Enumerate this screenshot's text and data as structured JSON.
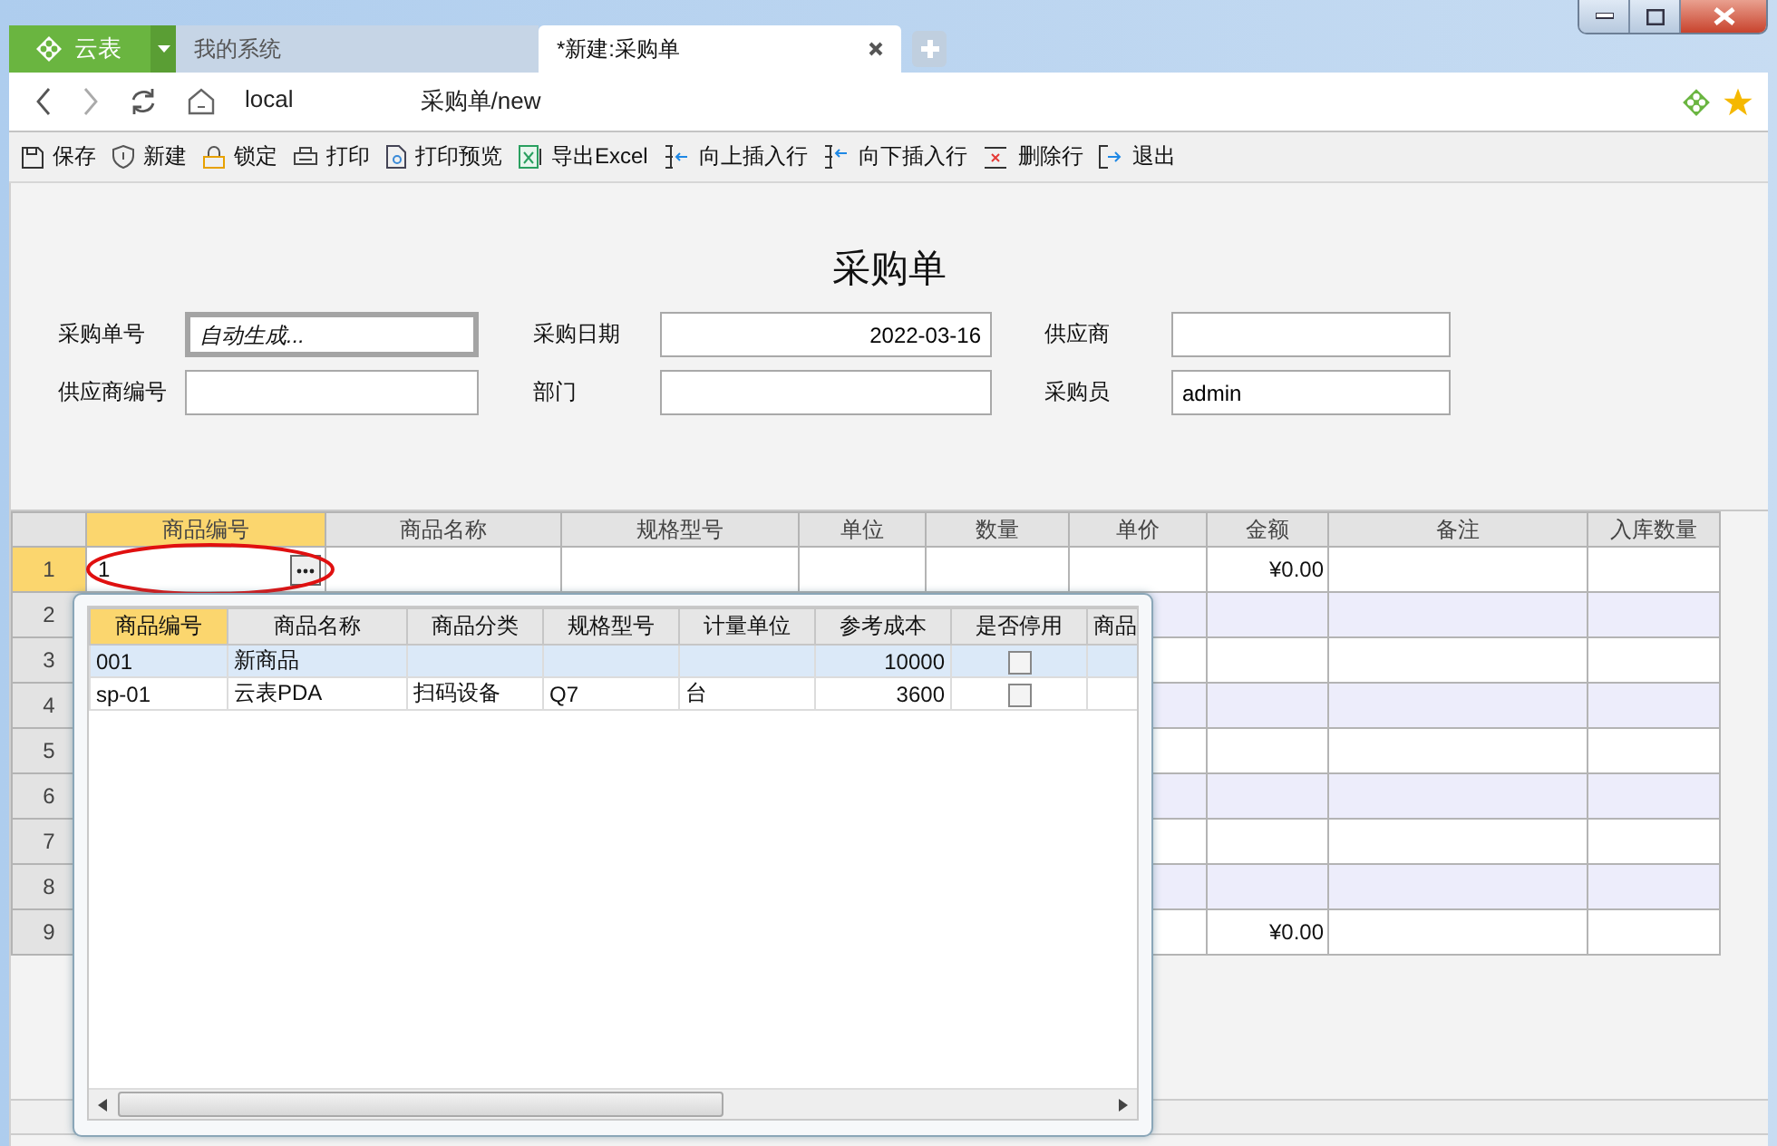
{
  "browser": {
    "app_tab": "云表",
    "tabs": [
      {
        "label": "我的系统",
        "selected": false
      },
      {
        "label": "*新建:采购单",
        "selected": true
      }
    ],
    "address": {
      "prefix": "local",
      "suffix": "采购单/new"
    }
  },
  "toolbar": [
    {
      "kind": "save",
      "label": "保存"
    },
    {
      "kind": "new",
      "label": "新建"
    },
    {
      "kind": "lock",
      "label": "锁定"
    },
    {
      "kind": "print",
      "label": "打印"
    },
    {
      "kind": "preview",
      "label": "打印预览"
    },
    {
      "kind": "excel",
      "label": "导出Excel"
    },
    {
      "kind": "insert-up",
      "label": "向上插入行"
    },
    {
      "kind": "insert-down",
      "label": "向下插入行"
    },
    {
      "kind": "delete-row",
      "label": "删除行"
    },
    {
      "kind": "exit",
      "label": "退出"
    }
  ],
  "form": {
    "title": "采购单",
    "fields": [
      {
        "label": "采购单号",
        "placeholder": "自动生成...",
        "focused": true
      },
      {
        "label": "采购日期",
        "value": "2022-03-16",
        "kind": "date"
      },
      {
        "label": "供应商"
      },
      {
        "label": "供应商编号"
      },
      {
        "label": "部门"
      },
      {
        "label": "采购员",
        "value": "admin"
      }
    ]
  },
  "grid": {
    "columns": [
      {
        "label": "商品编号",
        "selected": true
      },
      {
        "label": "商品名称",
        "selected": false
      },
      {
        "label": "规格型号",
        "selected": false
      },
      {
        "label": "单位",
        "selected": false
      },
      {
        "label": "数量",
        "selected": false
      },
      {
        "label": "单价",
        "selected": false
      },
      {
        "label": "金额",
        "selected": false
      },
      {
        "label": "备注",
        "selected": false
      },
      {
        "label": "入库数量",
        "selected": false
      }
    ],
    "rows": [
      {
        "number": "1",
        "selected": true,
        "editing_value": "1",
        "amount": "¥0.00"
      },
      {
        "number": "2",
        "selected": false
      },
      {
        "number": "3",
        "selected": false
      },
      {
        "number": "4",
        "selected": false
      },
      {
        "number": "5",
        "selected": false
      },
      {
        "number": "6",
        "selected": false
      },
      {
        "number": "7",
        "selected": false
      },
      {
        "number": "8",
        "selected": false
      },
      {
        "number": "9",
        "selected": false,
        "amount": "¥0.00"
      }
    ]
  },
  "popup": {
    "columns": [
      {
        "label": "商品编号",
        "selected": true
      },
      {
        "label": "商品名称",
        "selected": false
      },
      {
        "label": "商品分类",
        "selected": false
      },
      {
        "label": "规格型号",
        "selected": false
      },
      {
        "label": "计量单位",
        "selected": false
      },
      {
        "label": "参考成本",
        "selected": false
      },
      {
        "label": "是否停用",
        "selected": false
      },
      {
        "label": "商品",
        "selected": false
      }
    ],
    "rows": [
      {
        "selected": true,
        "code": "001",
        "name": "新商品",
        "cost": "10000",
        "stopped": false
      },
      {
        "selected": false,
        "code": "sp-01",
        "name": "云表PDA",
        "category": "扫码设备",
        "spec": "Q7",
        "unit": "台",
        "cost": "3600",
        "stopped": false
      }
    ]
  }
}
